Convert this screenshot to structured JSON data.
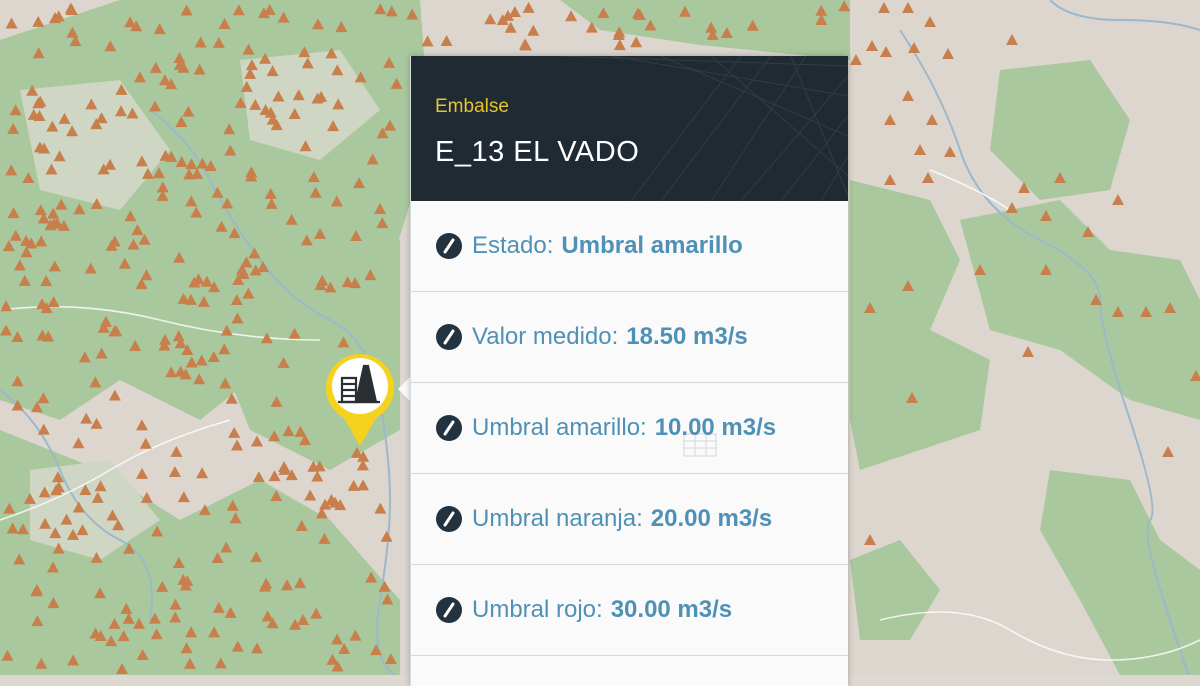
{
  "popup": {
    "type_label": "Embalse",
    "title": "E_13 EL VADO",
    "rows": [
      {
        "label": "Estado:",
        "value": "Umbral amarillo"
      },
      {
        "label": "Valor medido:",
        "value": "18.50 m3/s"
      },
      {
        "label": "Umbral amarillo:",
        "value": "10.00 m3/s"
      },
      {
        "label": "Umbral naranja:",
        "value": "20.00 m3/s"
      },
      {
        "label": "Umbral rojo:",
        "value": "30.00 m3/s"
      }
    ]
  },
  "map": {
    "marker_type": "reservoir-dam",
    "marker_status_color": "#f4d21d",
    "peak_icon": "mountain-peak-icon",
    "peak_color": "#c87f4c",
    "forest_color": "#a8c89c",
    "land_color": "#dcd6ce",
    "water_color": "#9ecae0"
  },
  "colors": {
    "header_bg": "#1f2a33",
    "header_type": "#e7c431",
    "row_text": "#4f91b6",
    "row_icon": "#23323f"
  }
}
